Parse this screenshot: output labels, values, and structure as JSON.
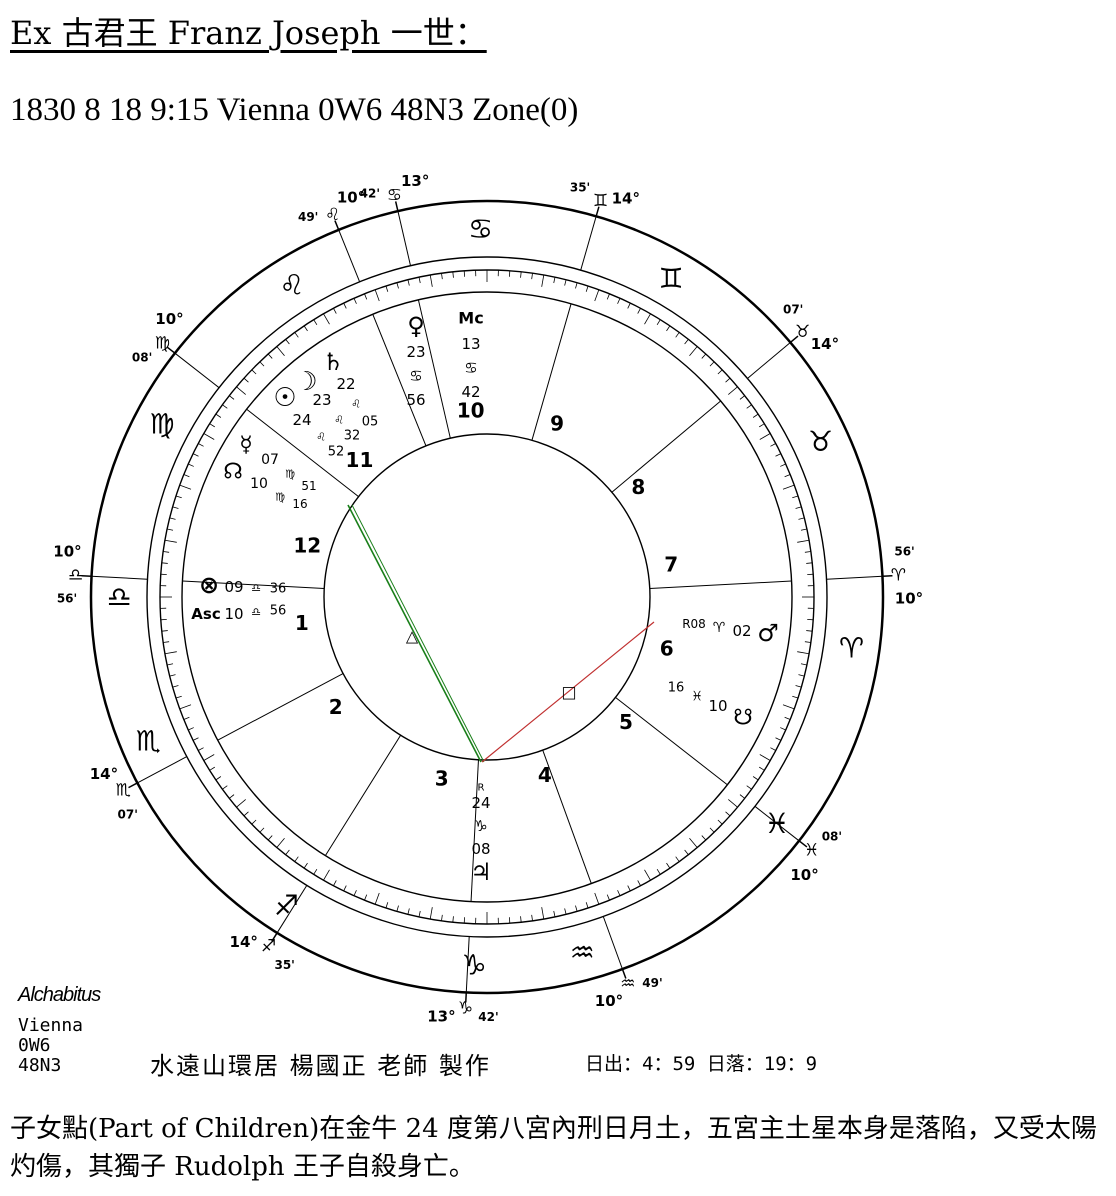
{
  "title": "Ex 古君王 Franz Joseph 一世：",
  "birth_info": "1830 8 18 9:15 Vienna 0W6 48N3 Zone(0)",
  "chart": {
    "outer": [
      {
        "deg": 103,
        "sym": "♋",
        "num": "13°",
        "min": "42'"
      },
      {
        "deg": 74,
        "sym": "♊",
        "num": "14°",
        "min": "35'"
      },
      {
        "deg": 40,
        "sym": "♉",
        "num": "14°",
        "min": "07'"
      },
      {
        "deg": 3,
        "sym": "♈",
        "num": "10°",
        "min": "56'"
      },
      {
        "deg": 322,
        "sym": "♓",
        "num": "10°",
        "min": "08'"
      },
      {
        "deg": 290,
        "sym": "♒",
        "num": "10°",
        "min": "49'"
      },
      {
        "deg": 267,
        "sym": "♑",
        "num": "13°",
        "min": "42'"
      },
      {
        "deg": 238,
        "sym": "♐",
        "num": "14°",
        "min": "35'"
      },
      {
        "deg": 208,
        "sym": "♏",
        "num": "14°",
        "min": "07'"
      },
      {
        "deg": 177,
        "sym": "♎",
        "num": "10°",
        "min": "56'"
      },
      {
        "deg": 142,
        "sym": "♍",
        "num": "10°",
        "min": "08'"
      },
      {
        "deg": 112,
        "sym": "♌",
        "num": "10°",
        "min": "49'"
      }
    ],
    "signs": [
      {
        "deg": 91,
        "sym": "♋"
      },
      {
        "deg": 60,
        "sym": "♊"
      },
      {
        "deg": 25,
        "sym": "♉"
      },
      {
        "deg": -8,
        "sym": "♈"
      },
      {
        "deg": -38,
        "sym": "♓"
      },
      {
        "deg": -75,
        "sym": "♒"
      },
      {
        "deg": -92,
        "sym": "♑"
      },
      {
        "deg": -123,
        "sym": "♐"
      },
      {
        "deg": -157,
        "sym": "♏"
      },
      {
        "deg": 180,
        "sym": "♎"
      },
      {
        "deg": 152,
        "sym": "♍"
      },
      {
        "deg": 122,
        "sym": "♌"
      }
    ],
    "houses": [
      {
        "deg": 188,
        "num": "1"
      },
      {
        "deg": 216,
        "num": "2"
      },
      {
        "deg": 256,
        "num": "3"
      },
      {
        "deg": 288,
        "num": "4"
      },
      {
        "deg": 318,
        "num": "5"
      },
      {
        "deg": 344,
        "num": "6"
      },
      {
        "deg": 10,
        "num": "7"
      },
      {
        "deg": 36,
        "num": "8"
      },
      {
        "deg": 68,
        "num": "9"
      },
      {
        "deg": 95,
        "num": "10"
      },
      {
        "deg": 133,
        "num": "11"
      },
      {
        "deg": 164,
        "num": "12"
      }
    ],
    "planets": [
      {
        "glyph": "♀",
        "lines": [
          "23",
          "♋",
          "56"
        ]
      },
      {
        "glyph": "Mc",
        "lines": [
          "13",
          "♋",
          "42"
        ]
      },
      {
        "glyph": "♄",
        "lines": [
          "22",
          "♌",
          "05"
        ]
      },
      {
        "glyph": "☽",
        "lines": [
          "23",
          "♌",
          "32"
        ]
      },
      {
        "glyph": "☉",
        "lines": [
          "24",
          "♌",
          "52"
        ]
      },
      {
        "glyph": "☿",
        "lines": [
          "07",
          "♍",
          "51"
        ]
      },
      {
        "glyph": "☊",
        "lines": [
          "10",
          "♍",
          "16"
        ]
      },
      {
        "glyph": "⊗",
        "lines": [
          "09",
          "♎",
          "36"
        ]
      },
      {
        "glyph": "Asc",
        "lines": [
          "10",
          "♎",
          "56"
        ]
      },
      {
        "glyph": "♂",
        "lines": [
          "R08",
          "♈",
          "02"
        ]
      },
      {
        "glyph": "☋",
        "lines": [
          "16",
          "♓",
          "10"
        ]
      },
      {
        "glyph": "♃",
        "lines": [
          "R",
          "24",
          "♑",
          "08"
        ]
      }
    ],
    "aspects": [
      {
        "name": "trine",
        "symbol": "△",
        "color": "#1a7f1a"
      },
      {
        "name": "square",
        "symbol": "□",
        "color": "#c03030"
      }
    ]
  },
  "footer": {
    "system": "Alchabitus",
    "location_lines": [
      "Vienna",
      "0W6",
      "48N3"
    ],
    "maker": "水遠山環居 楊國正 老師 製作",
    "sun_times": "日出：4：59 日落：19：9"
  },
  "paragraph": "子女點(Part of Children)在金牛 24 度第八宮內刑日月土，五宮主土星本身是落陷，又受太陽灼傷，其獨子 Rudolph 王子自殺身亡。"
}
